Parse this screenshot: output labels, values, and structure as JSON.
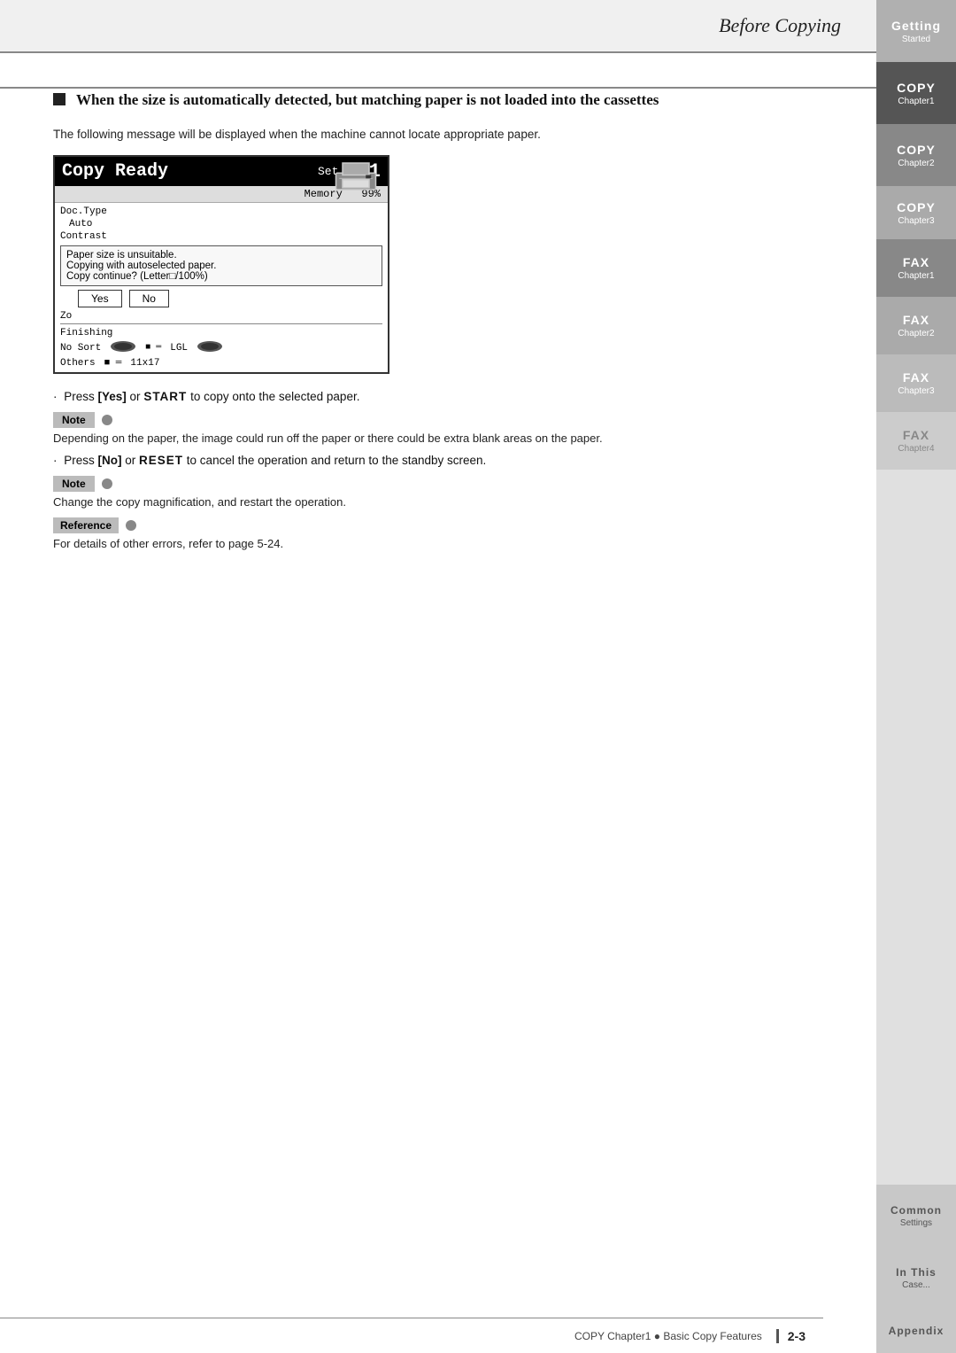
{
  "header": {
    "title": "Before Copying"
  },
  "section": {
    "heading": "When the size is automatically detected, but matching paper is not loaded into the cassettes",
    "intro": "The following message will be displayed when the machine cannot locate appropriate paper."
  },
  "screen": {
    "title": "Copy Ready",
    "set_label": "Set",
    "set_number": "001",
    "memory_label": "Memory",
    "memory_value": "99%",
    "doc_type_label": "Doc.Type",
    "doc_type_value": "Auto",
    "contrast_label": "Contrast",
    "message_line1": "Paper size is unsuitable.",
    "message_line2": "Copying with autoselected paper.",
    "message_line3": "Copy continue? (Letter□/100%)",
    "yes_button": "Yes",
    "no_button": "No",
    "finishing_label": "Finishing",
    "no_sort_label": "No Sort",
    "others_label": "Others",
    "lgl_label": "LGL",
    "size_label": "11x17",
    "zoom_label": "Zo"
  },
  "instructions": {
    "press_yes": "Press [Yes] or START to copy onto the selected paper.",
    "note1_label": "Note",
    "note1_text": "Depending on the paper, the image could run off the paper or there could be extra blank areas on the paper.",
    "press_no": "Press [No] or RESET to cancel the operation and return to the standby screen.",
    "note2_label": "Note",
    "note2_text": "Change the copy magnification, and restart the operation.",
    "reference_label": "Reference",
    "reference_text": "For details of other errors, refer to page 5-24."
  },
  "footer": {
    "text": "COPY Chapter1 ● Basic Copy Features",
    "page_number": "2-3"
  },
  "sidebar": {
    "tabs": [
      {
        "main": "Getting",
        "sub": "Started"
      },
      {
        "main": "COPY",
        "sub": "Chapter1"
      },
      {
        "main": "COPY",
        "sub": "Chapter2"
      },
      {
        "main": "COPY",
        "sub": "Chapter3"
      },
      {
        "main": "FAX",
        "sub": "Chapter1"
      },
      {
        "main": "FAX",
        "sub": "Chapter2"
      },
      {
        "main": "FAX",
        "sub": "Chapter3"
      },
      {
        "main": "FAX",
        "sub": "Chapter4"
      },
      {
        "main": "Common",
        "sub": "Settings"
      },
      {
        "main": "In This",
        "sub": "Case..."
      },
      {
        "main": "Appendix",
        "sub": ""
      }
    ]
  }
}
